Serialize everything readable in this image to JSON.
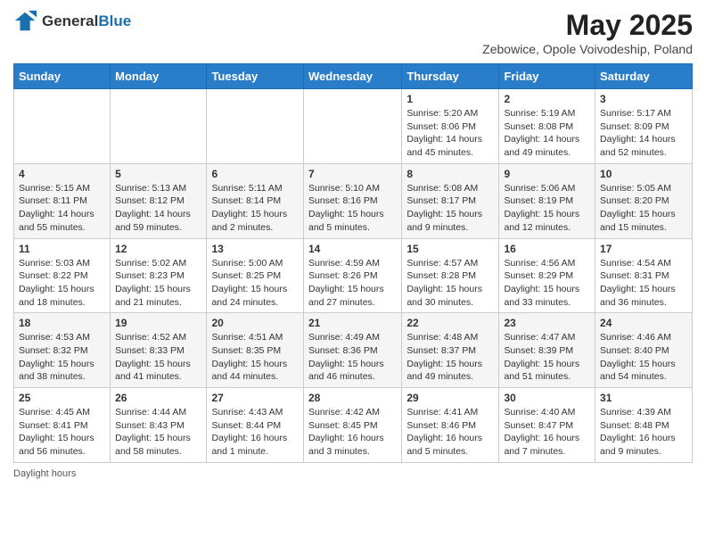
{
  "header": {
    "logo": {
      "general": "General",
      "blue": "Blue"
    },
    "title": "May 2025",
    "location": "Zebowice, Opole Voivodeship, Poland"
  },
  "calendar": {
    "weekdays": [
      "Sunday",
      "Monday",
      "Tuesday",
      "Wednesday",
      "Thursday",
      "Friday",
      "Saturday"
    ],
    "weeks": [
      [
        {
          "day": "",
          "info": ""
        },
        {
          "day": "",
          "info": ""
        },
        {
          "day": "",
          "info": ""
        },
        {
          "day": "",
          "info": ""
        },
        {
          "day": "1",
          "info": "Sunrise: 5:20 AM\nSunset: 8:06 PM\nDaylight: 14 hours\nand 45 minutes."
        },
        {
          "day": "2",
          "info": "Sunrise: 5:19 AM\nSunset: 8:08 PM\nDaylight: 14 hours\nand 49 minutes."
        },
        {
          "day": "3",
          "info": "Sunrise: 5:17 AM\nSunset: 8:09 PM\nDaylight: 14 hours\nand 52 minutes."
        }
      ],
      [
        {
          "day": "4",
          "info": "Sunrise: 5:15 AM\nSunset: 8:11 PM\nDaylight: 14 hours\nand 55 minutes."
        },
        {
          "day": "5",
          "info": "Sunrise: 5:13 AM\nSunset: 8:12 PM\nDaylight: 14 hours\nand 59 minutes."
        },
        {
          "day": "6",
          "info": "Sunrise: 5:11 AM\nSunset: 8:14 PM\nDaylight: 15 hours\nand 2 minutes."
        },
        {
          "day": "7",
          "info": "Sunrise: 5:10 AM\nSunset: 8:16 PM\nDaylight: 15 hours\nand 5 minutes."
        },
        {
          "day": "8",
          "info": "Sunrise: 5:08 AM\nSunset: 8:17 PM\nDaylight: 15 hours\nand 9 minutes."
        },
        {
          "day": "9",
          "info": "Sunrise: 5:06 AM\nSunset: 8:19 PM\nDaylight: 15 hours\nand 12 minutes."
        },
        {
          "day": "10",
          "info": "Sunrise: 5:05 AM\nSunset: 8:20 PM\nDaylight: 15 hours\nand 15 minutes."
        }
      ],
      [
        {
          "day": "11",
          "info": "Sunrise: 5:03 AM\nSunset: 8:22 PM\nDaylight: 15 hours\nand 18 minutes."
        },
        {
          "day": "12",
          "info": "Sunrise: 5:02 AM\nSunset: 8:23 PM\nDaylight: 15 hours\nand 21 minutes."
        },
        {
          "day": "13",
          "info": "Sunrise: 5:00 AM\nSunset: 8:25 PM\nDaylight: 15 hours\nand 24 minutes."
        },
        {
          "day": "14",
          "info": "Sunrise: 4:59 AM\nSunset: 8:26 PM\nDaylight: 15 hours\nand 27 minutes."
        },
        {
          "day": "15",
          "info": "Sunrise: 4:57 AM\nSunset: 8:28 PM\nDaylight: 15 hours\nand 30 minutes."
        },
        {
          "day": "16",
          "info": "Sunrise: 4:56 AM\nSunset: 8:29 PM\nDaylight: 15 hours\nand 33 minutes."
        },
        {
          "day": "17",
          "info": "Sunrise: 4:54 AM\nSunset: 8:31 PM\nDaylight: 15 hours\nand 36 minutes."
        }
      ],
      [
        {
          "day": "18",
          "info": "Sunrise: 4:53 AM\nSunset: 8:32 PM\nDaylight: 15 hours\nand 38 minutes."
        },
        {
          "day": "19",
          "info": "Sunrise: 4:52 AM\nSunset: 8:33 PM\nDaylight: 15 hours\nand 41 minutes."
        },
        {
          "day": "20",
          "info": "Sunrise: 4:51 AM\nSunset: 8:35 PM\nDaylight: 15 hours\nand 44 minutes."
        },
        {
          "day": "21",
          "info": "Sunrise: 4:49 AM\nSunset: 8:36 PM\nDaylight: 15 hours\nand 46 minutes."
        },
        {
          "day": "22",
          "info": "Sunrise: 4:48 AM\nSunset: 8:37 PM\nDaylight: 15 hours\nand 49 minutes."
        },
        {
          "day": "23",
          "info": "Sunrise: 4:47 AM\nSunset: 8:39 PM\nDaylight: 15 hours\nand 51 minutes."
        },
        {
          "day": "24",
          "info": "Sunrise: 4:46 AM\nSunset: 8:40 PM\nDaylight: 15 hours\nand 54 minutes."
        }
      ],
      [
        {
          "day": "25",
          "info": "Sunrise: 4:45 AM\nSunset: 8:41 PM\nDaylight: 15 hours\nand 56 minutes."
        },
        {
          "day": "26",
          "info": "Sunrise: 4:44 AM\nSunset: 8:43 PM\nDaylight: 15 hours\nand 58 minutes."
        },
        {
          "day": "27",
          "info": "Sunrise: 4:43 AM\nSunset: 8:44 PM\nDaylight: 16 hours\nand 1 minute."
        },
        {
          "day": "28",
          "info": "Sunrise: 4:42 AM\nSunset: 8:45 PM\nDaylight: 16 hours\nand 3 minutes."
        },
        {
          "day": "29",
          "info": "Sunrise: 4:41 AM\nSunset: 8:46 PM\nDaylight: 16 hours\nand 5 minutes."
        },
        {
          "day": "30",
          "info": "Sunrise: 4:40 AM\nSunset: 8:47 PM\nDaylight: 16 hours\nand 7 minutes."
        },
        {
          "day": "31",
          "info": "Sunrise: 4:39 AM\nSunset: 8:48 PM\nDaylight: 16 hours\nand 9 minutes."
        }
      ]
    ]
  },
  "footer": {
    "daylight_hours": "Daylight hours"
  }
}
